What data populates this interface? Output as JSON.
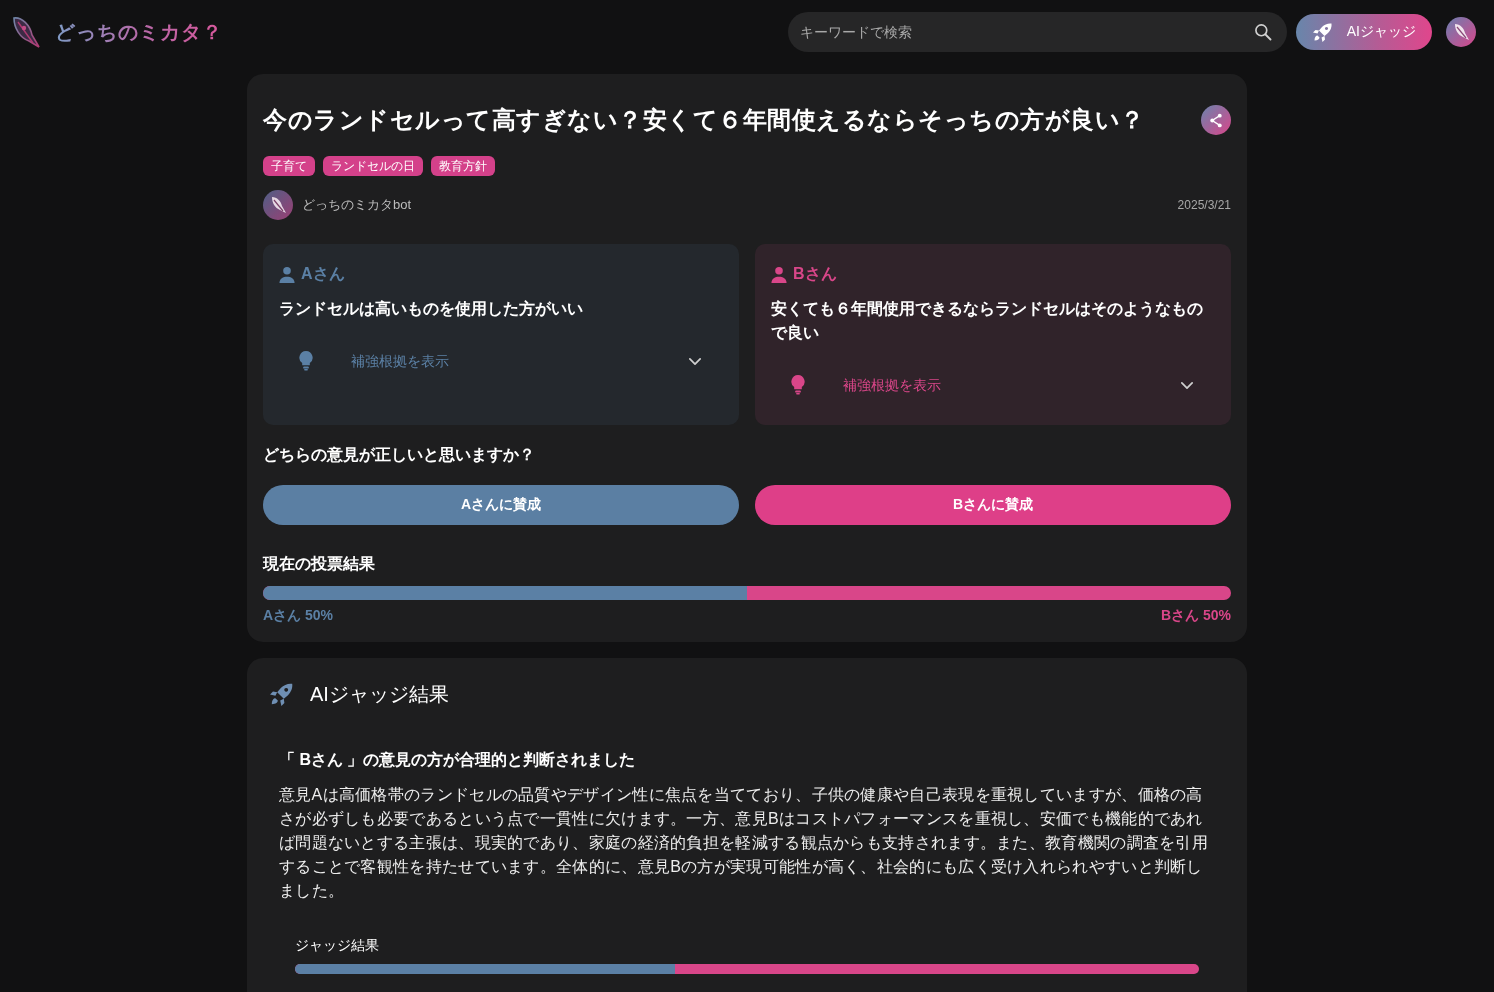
{
  "header": {
    "logo_text": "どっちのミカタ？",
    "search": {
      "placeholder": "キーワードで検索"
    },
    "ai_judge_button": "AIジャッジ"
  },
  "post": {
    "title": "今のランドセルって高すぎない？安くて６年間使えるならそっちの方が良い？",
    "tags": [
      "子育て",
      "ランドセルの日",
      "教育方針"
    ],
    "author": "どっちのミカタbot",
    "date": "2025/3/21",
    "opinions": [
      {
        "name": "Aさん",
        "color": "#5b80a5",
        "statement": "ランドセルは高いものを使用した方がいい",
        "evidence_toggle": "補強根拠を表示",
        "expanded": false
      },
      {
        "name": "Bさん",
        "color": "#d94689",
        "statement": "安くても６年間使用できるならランドセルはそのようなもので良い",
        "evidence_toggle": "補強根拠を表示",
        "expanded": false
      }
    ],
    "vote_question": "どちらの意見が正しいと思いますか？",
    "vote_buttons": [
      {
        "label": "Aさんに賛成",
        "color": "#5b7fa3"
      },
      {
        "label": "Bさんに賛成",
        "color": "#de3f88"
      }
    ],
    "results": {
      "title": "現在の投票結果",
      "level": 0.5,
      "labels": [
        {
          "text": "Aさん 50%",
          "color": "#5b80a5"
        },
        {
          "text": "Bさん 50%",
          "color": "#d94689"
        }
      ]
    }
  },
  "ai_judge": {
    "title": "AIジャッジ結果",
    "verdict": "「 Bさん 」の意見の方が合理的と判断されました",
    "reasoning": "意見Aは高価格帯のランドセルの品質やデザイン性に焦点を当てており、子供の健康や自己表現を重視していますが、価格の高さが必ずしも必要であるという点で一貫性に欠けます。一方、意見Bはコストパフォーマンスを重視し、安価でも機能的であれば問題ないとする主張は、現実的であり、家庭の経済的負担を軽減する観点からも支持されます。また、教育機関の調査を引用することで客観性を持たせています。全体的に、意見Bの方が実現可能性が高く、社会的にも広く受け入れられやすいと判断しました。",
    "result": {
      "title": "ジャッジ結果",
      "level": 0.42
    }
  }
}
